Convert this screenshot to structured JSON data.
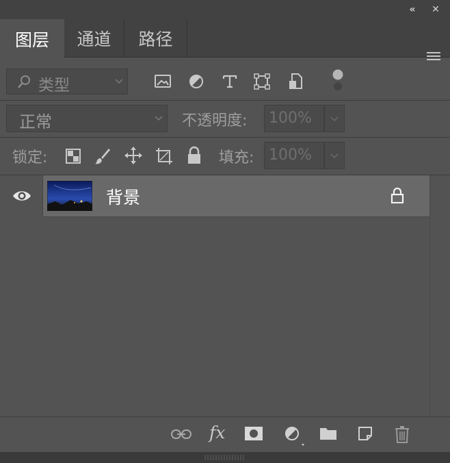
{
  "titlebar": {
    "collapse_glyph": "«",
    "close_glyph": "✕"
  },
  "tabs": [
    {
      "label": "图层",
      "active": true
    },
    {
      "label": "通道",
      "active": false
    },
    {
      "label": "路径",
      "active": false
    }
  ],
  "filter": {
    "kind_label": "类型",
    "icons": [
      "image-filter-icon",
      "adjustment-filter-icon",
      "type-filter-icon",
      "shape-filter-icon",
      "smart-object-filter-icon",
      "filter-toggle-icon"
    ]
  },
  "blend": {
    "mode": "正常",
    "opacity_label": "不透明度:",
    "opacity_value": "100%"
  },
  "lock": {
    "label": "锁定:",
    "icons": [
      "lock-transparent-pixels-icon",
      "lock-image-pixels-icon",
      "lock-position-icon",
      "lock-artboard-icon",
      "lock-all-icon"
    ],
    "fill_label": "填充:",
    "fill_value": "100%"
  },
  "layers": [
    {
      "name": "背景",
      "visible": true,
      "locked": true
    }
  ],
  "bottom_toolbar": {
    "icons": [
      "link-layers-icon",
      "fx-icon",
      "layer-mask-icon",
      "adjustment-layer-icon",
      "group-folder-icon",
      "new-layer-icon",
      "trash-icon"
    ],
    "fx_text": "fx"
  },
  "colors": {
    "panel_bg": "#535353",
    "tab_bar_bg": "#424242",
    "layer_selected_bg": "#696969",
    "icon_color": "#c8c8c8"
  }
}
